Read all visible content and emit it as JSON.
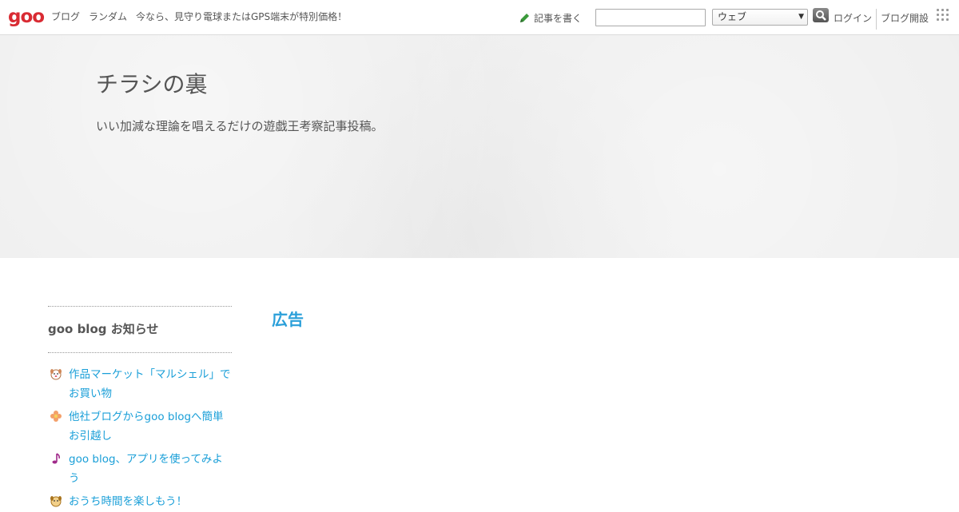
{
  "topbar": {
    "logo_text": "goo",
    "nav": [
      "ブログ",
      "ランダム",
      "今なら、見守り電球またはGPS端末が特別価格！"
    ],
    "write_label": "記事を書く",
    "search_value": "",
    "search_scope": "ウェブ",
    "login_label": "ログイン",
    "blog_open_label": "ブログ開設",
    "icons": [
      "pencil-icon",
      "search-icon",
      "app-grid-icon"
    ],
    "logo_color": "#d92b33"
  },
  "header": {
    "title": "チラシの裏",
    "description": "いい加減な理論を唱えるだけの遊戯王考察記事投稿。"
  },
  "sidebar": {
    "heading": "goo blog お知らせ",
    "items": [
      {
        "label": "作品マーケット「マルシェル」でお買い物",
        "icon": "dog-face-icon"
      },
      {
        "label": "他社ブログからgoo blogへ簡単お引越し",
        "icon": "flower-icon"
      },
      {
        "label": "goo blog、アプリを使ってみよう",
        "icon": "music-note-icon"
      },
      {
        "label": "おうち時間を楽しもう！",
        "icon": "dog-face-icon"
      }
    ]
  },
  "main": {
    "ad_heading": "広告"
  },
  "colors": {
    "link": "#1a9fd8",
    "ad_heading": "#2a9fd9",
    "header_bg": "#eeeeee"
  }
}
